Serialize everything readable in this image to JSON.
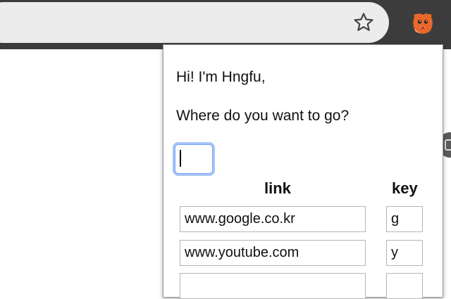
{
  "browser": {
    "bookmark_icon": "star-outline-icon",
    "extension_icon": "hngfu-mascot-icon"
  },
  "popup": {
    "greeting": "Hi! I'm Hngfu,",
    "question": "Where do you want to go?",
    "go_input_value": "",
    "columns": {
      "link": "link",
      "key": "key"
    },
    "rows": [
      {
        "link": "www.google.co.kr",
        "key": "g"
      },
      {
        "link": "www.youtube.com",
        "key": "y"
      },
      {
        "link": "",
        "key": ""
      }
    ]
  },
  "colors": {
    "toolbar": "#3c3c3c",
    "omnibox": "#ececec",
    "focus_ring": "#a6c3f7",
    "mascot_orange": "#e8672a"
  }
}
